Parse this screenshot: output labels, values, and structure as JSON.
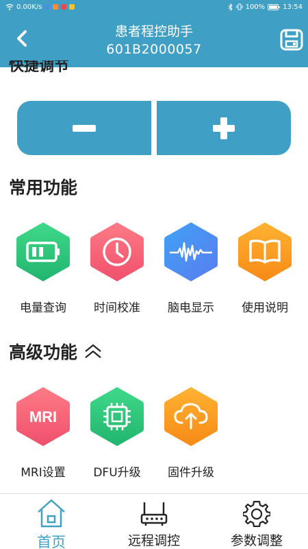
{
  "status_bar": {
    "speed": "0.00K/s",
    "battery": "100%",
    "time": "13:54"
  },
  "header": {
    "title": "患者程控助手",
    "subtitle": "601B2000057"
  },
  "quick_adjust": {
    "title": "快捷调节"
  },
  "common": {
    "title": "常用功能",
    "items": [
      {
        "label": "电量查询",
        "icon": "battery-icon"
      },
      {
        "label": "时间校准",
        "icon": "clock-icon"
      },
      {
        "label": "脑电显示",
        "icon": "waveform-icon"
      },
      {
        "label": "使用说明",
        "icon": "book-icon"
      }
    ]
  },
  "advanced": {
    "title": "高级功能",
    "items": [
      {
        "label": "MRI设置",
        "icon": "mri-icon",
        "icon_text": "MRI"
      },
      {
        "label": "DFU升级",
        "icon": "chip-icon"
      },
      {
        "label": "固件升级",
        "icon": "cloud-upload-icon"
      }
    ]
  },
  "nav": {
    "items": [
      {
        "label": "首页",
        "icon": "home-icon",
        "active": true
      },
      {
        "label": "远程调控",
        "icon": "router-icon",
        "active": false
      },
      {
        "label": "参数调整",
        "icon": "gear-icon",
        "active": false
      }
    ]
  },
  "colors": {
    "primary": "#3f9fc4",
    "green": "#2dc57c",
    "pink": "#f7657a",
    "blue": "#4b8df0",
    "orange": "#fb9a1e"
  }
}
